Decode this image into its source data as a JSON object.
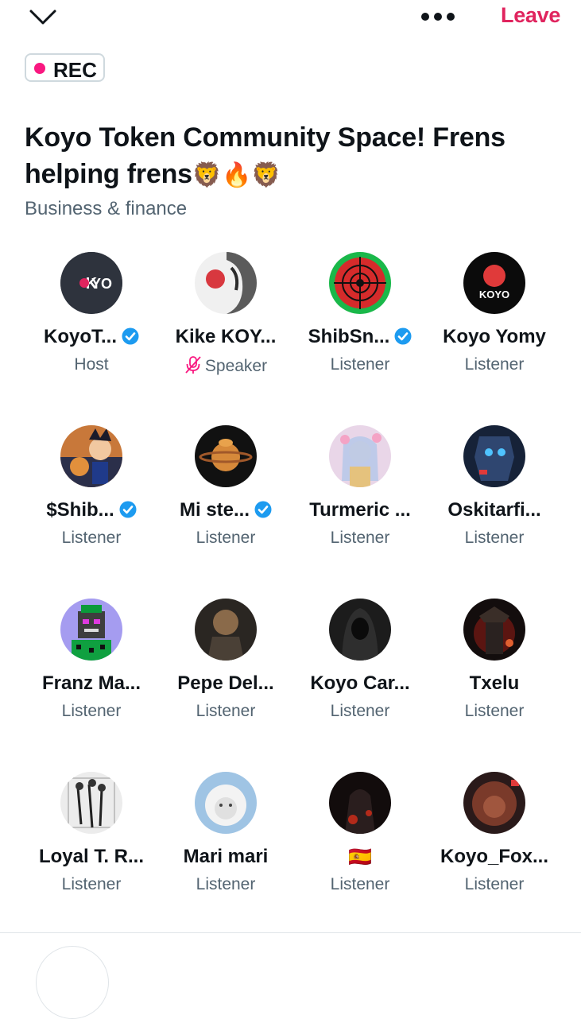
{
  "header": {
    "leave_label": "Leave",
    "rec_label": "REC",
    "accent_color": "#e0245e"
  },
  "space": {
    "title_line1": "Koyo Token Community Space! Frens",
    "title_line2": "helping frens",
    "title_emojis": "🦁🔥🦁",
    "category": "Business & finance"
  },
  "participants": [
    {
      "name": "KoyoT...",
      "role": "Host",
      "verified": true,
      "avatar": "koyo-logo"
    },
    {
      "name": "Kike KOY...",
      "role": "Speaker",
      "verified": false,
      "muted": true,
      "avatar": "samurai"
    },
    {
      "name": "ShibSn...",
      "role": "Listener",
      "verified": true,
      "avatar": "target"
    },
    {
      "name": "Koyo Yomy",
      "role": "Listener",
      "verified": false,
      "avatar": "koyo-red"
    },
    {
      "name": "$Shib...",
      "role": "Listener",
      "verified": true,
      "avatar": "anime-dog"
    },
    {
      "name": "Mi ste...",
      "role": "Listener",
      "verified": true,
      "avatar": "planet"
    },
    {
      "name": "Turmeric ...",
      "role": "Listener",
      "verified": false,
      "avatar": "anime-girl"
    },
    {
      "name": "Oskitarfi...",
      "role": "Listener",
      "verified": false,
      "avatar": "robot"
    },
    {
      "name": "Franz Ma...",
      "role": "Listener",
      "verified": false,
      "avatar": "pixel-punk"
    },
    {
      "name": "Pepe Del...",
      "role": "Listener",
      "verified": false,
      "avatar": "lion-warrior"
    },
    {
      "name": "Koyo Car...",
      "role": "Listener",
      "verified": false,
      "avatar": "hooded"
    },
    {
      "name": "Txelu",
      "role": "Listener",
      "verified": false,
      "avatar": "samurai-red"
    },
    {
      "name": "Loyal T. R...",
      "role": "Listener",
      "verified": false,
      "avatar": "sketch"
    },
    {
      "name": "Mari mari",
      "role": "Listener",
      "verified": false,
      "avatar": "white-lion"
    },
    {
      "name": "🇪🇸",
      "role": "Listener",
      "verified": false,
      "avatar": "dark-warrior"
    },
    {
      "name": "Koyo_Fox...",
      "role": "Listener",
      "verified": false,
      "avatar": "red-lion"
    }
  ]
}
